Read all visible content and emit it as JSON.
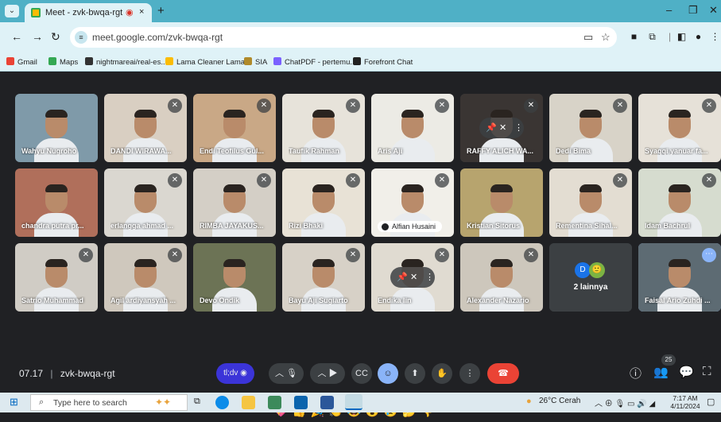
{
  "browser": {
    "tab_title": "Meet - zvk-bwqa-rgt",
    "tab_recording_icon": "record-icon",
    "tab_close": "×",
    "new_tab": "+",
    "url": "meet.google.com/zvk-bwqa-rgt",
    "accent": "#4fb0c6",
    "bookmarks": [
      "Gmail",
      "Maps",
      "nightmareai/real-es...",
      "Lama Cleaner Lama...",
      "SIA",
      "ChatPDF - pertemu...",
      "Forefront Chat"
    ]
  },
  "tiles": [
    {
      "name": "Wahyu Nugroho",
      "muted": false,
      "bg": "#7f9aa9"
    },
    {
      "name": "DANDI WIRAWA...",
      "muted": true,
      "bg": "#d9cfc2"
    },
    {
      "name": "Endi Teofilus Gul...",
      "muted": true,
      "bg": "#c9a886"
    },
    {
      "name": "Taufik Rahman",
      "muted": true,
      "bg": "#e7e3da"
    },
    {
      "name": "Aris Aji",
      "muted": true,
      "bg": "#ecebe5"
    },
    {
      "name": "RAFFY ALICH WA...",
      "muted": true,
      "bg": "#3a3533"
    },
    {
      "name": "Dedi Bima",
      "muted": true,
      "bg": "#d8d3c8"
    },
    {
      "name": "Syaqqi yanuar fa...",
      "muted": true,
      "bg": "#e6e1d8"
    },
    {
      "name": "chandra putra pr...",
      "muted": false,
      "bg": "#b06f5b"
    },
    {
      "name": "erlangga ahmad ...",
      "muted": true,
      "bg": "#dad7d0"
    },
    {
      "name": "RIMBA JAYAKUS...",
      "muted": true,
      "bg": "#d4cfc6"
    },
    {
      "name": "Rizi Bhaki",
      "muted": true,
      "bg": "#e8e2d6"
    },
    {
      "name": "Alfian Husaini",
      "muted": true,
      "bg": "#f1efe9"
    },
    {
      "name": "Kristian Sitorus",
      "muted": false,
      "bg": "#b7a46e"
    },
    {
      "name": "Rementina Sihal...",
      "muted": true,
      "bg": "#e3ddd2"
    },
    {
      "name": "Idam Bachrul",
      "muted": true,
      "bg": "#d6dccf"
    },
    {
      "name": "Satrio Muhammad",
      "muted": true,
      "bg": "#d0ccc5"
    },
    {
      "name": "Agil ardiyansyah ...",
      "muted": true,
      "bg": "#cfc8bd"
    },
    {
      "name": "Devo Ondik",
      "muted": false,
      "bg": "#6c7355"
    },
    {
      "name": "Bayu Aji Sugiarto",
      "muted": true,
      "bg": "#d7d1c7"
    },
    {
      "name": "Endika Iin",
      "muted": true,
      "bg": "#e0dbd1"
    },
    {
      "name": "Alexander Nazario",
      "muted": true,
      "bg": "#cdc7bc"
    },
    {
      "name": "2 lainnya",
      "muted": false,
      "bg": "#3c4043"
    },
    {
      "name": "Faisal Ario Zuhdi ...",
      "muted": false,
      "bg": "#5d6b73"
    }
  ],
  "others_avatars": [
    "D",
    "🙂"
  ],
  "reactions": [
    "💖",
    "👍",
    "🎉",
    "👏",
    "😂",
    "😮",
    "😢",
    "🤔",
    "👎"
  ],
  "meeting": {
    "time": "07.17",
    "separator": "|",
    "code": "zvk-bwqa-rgt",
    "extension_label": "tl;dv",
    "participant_count": "25",
    "leave_color": "#ea4335"
  },
  "controls": [
    "chevron-up-icon",
    "mic-icon",
    "chevron-up-icon",
    "camera-icon",
    "captions-icon",
    "emoji-icon",
    "present-icon",
    "raise-hand-icon",
    "more-icon",
    "leave-call-icon"
  ],
  "taskbar": {
    "search_placeholder": "Type here to search",
    "weather": "26°C  Cerah",
    "time": "7:17 AM",
    "date": "4/11/2024"
  }
}
